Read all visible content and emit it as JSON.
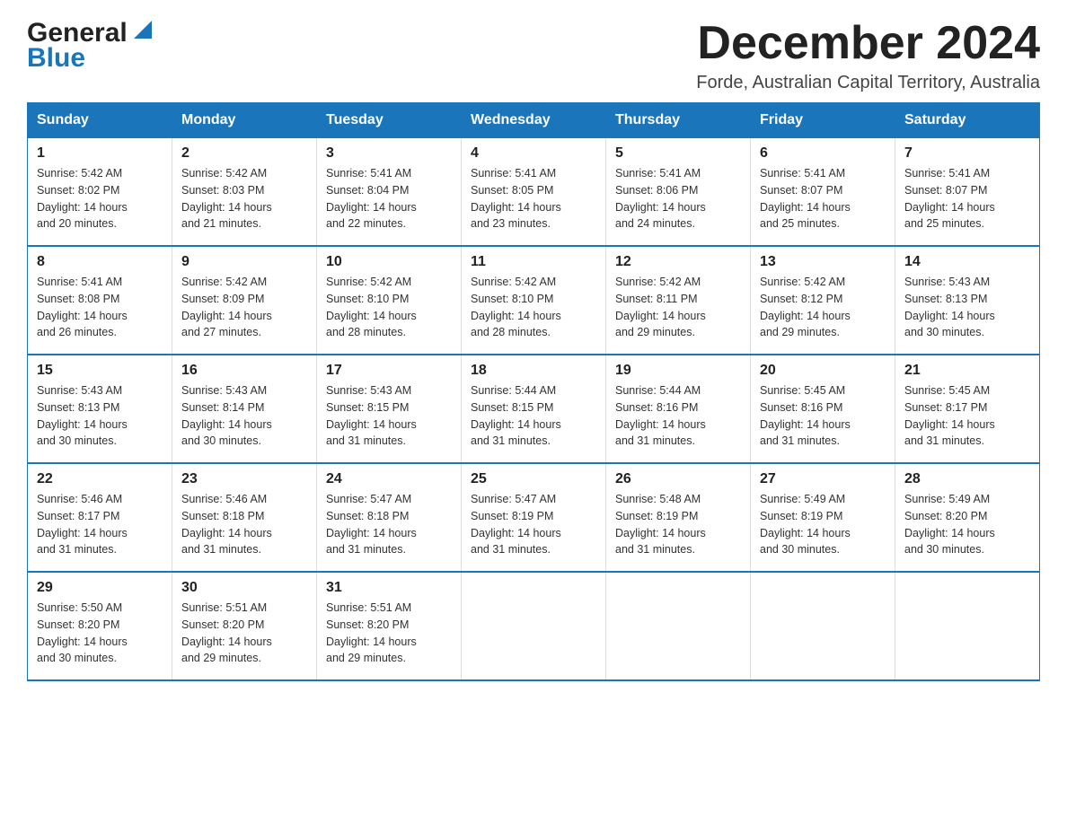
{
  "header": {
    "logo_general": "General",
    "logo_blue": "Blue",
    "month_title": "December 2024",
    "location": "Forde, Australian Capital Territory, Australia"
  },
  "days_of_week": [
    "Sunday",
    "Monday",
    "Tuesday",
    "Wednesday",
    "Thursday",
    "Friday",
    "Saturday"
  ],
  "weeks": [
    [
      {
        "day": "1",
        "sunrise": "5:42 AM",
        "sunset": "8:02 PM",
        "daylight": "14 hours and 20 minutes."
      },
      {
        "day": "2",
        "sunrise": "5:42 AM",
        "sunset": "8:03 PM",
        "daylight": "14 hours and 21 minutes."
      },
      {
        "day": "3",
        "sunrise": "5:41 AM",
        "sunset": "8:04 PM",
        "daylight": "14 hours and 22 minutes."
      },
      {
        "day": "4",
        "sunrise": "5:41 AM",
        "sunset": "8:05 PM",
        "daylight": "14 hours and 23 minutes."
      },
      {
        "day": "5",
        "sunrise": "5:41 AM",
        "sunset": "8:06 PM",
        "daylight": "14 hours and 24 minutes."
      },
      {
        "day": "6",
        "sunrise": "5:41 AM",
        "sunset": "8:07 PM",
        "daylight": "14 hours and 25 minutes."
      },
      {
        "day": "7",
        "sunrise": "5:41 AM",
        "sunset": "8:07 PM",
        "daylight": "14 hours and 25 minutes."
      }
    ],
    [
      {
        "day": "8",
        "sunrise": "5:41 AM",
        "sunset": "8:08 PM",
        "daylight": "14 hours and 26 minutes."
      },
      {
        "day": "9",
        "sunrise": "5:42 AM",
        "sunset": "8:09 PM",
        "daylight": "14 hours and 27 minutes."
      },
      {
        "day": "10",
        "sunrise": "5:42 AM",
        "sunset": "8:10 PM",
        "daylight": "14 hours and 28 minutes."
      },
      {
        "day": "11",
        "sunrise": "5:42 AM",
        "sunset": "8:10 PM",
        "daylight": "14 hours and 28 minutes."
      },
      {
        "day": "12",
        "sunrise": "5:42 AM",
        "sunset": "8:11 PM",
        "daylight": "14 hours and 29 minutes."
      },
      {
        "day": "13",
        "sunrise": "5:42 AM",
        "sunset": "8:12 PM",
        "daylight": "14 hours and 29 minutes."
      },
      {
        "day": "14",
        "sunrise": "5:43 AM",
        "sunset": "8:13 PM",
        "daylight": "14 hours and 30 minutes."
      }
    ],
    [
      {
        "day": "15",
        "sunrise": "5:43 AM",
        "sunset": "8:13 PM",
        "daylight": "14 hours and 30 minutes."
      },
      {
        "day": "16",
        "sunrise": "5:43 AM",
        "sunset": "8:14 PM",
        "daylight": "14 hours and 30 minutes."
      },
      {
        "day": "17",
        "sunrise": "5:43 AM",
        "sunset": "8:15 PM",
        "daylight": "14 hours and 31 minutes."
      },
      {
        "day": "18",
        "sunrise": "5:44 AM",
        "sunset": "8:15 PM",
        "daylight": "14 hours and 31 minutes."
      },
      {
        "day": "19",
        "sunrise": "5:44 AM",
        "sunset": "8:16 PM",
        "daylight": "14 hours and 31 minutes."
      },
      {
        "day": "20",
        "sunrise": "5:45 AM",
        "sunset": "8:16 PM",
        "daylight": "14 hours and 31 minutes."
      },
      {
        "day": "21",
        "sunrise": "5:45 AM",
        "sunset": "8:17 PM",
        "daylight": "14 hours and 31 minutes."
      }
    ],
    [
      {
        "day": "22",
        "sunrise": "5:46 AM",
        "sunset": "8:17 PM",
        "daylight": "14 hours and 31 minutes."
      },
      {
        "day": "23",
        "sunrise": "5:46 AM",
        "sunset": "8:18 PM",
        "daylight": "14 hours and 31 minutes."
      },
      {
        "day": "24",
        "sunrise": "5:47 AM",
        "sunset": "8:18 PM",
        "daylight": "14 hours and 31 minutes."
      },
      {
        "day": "25",
        "sunrise": "5:47 AM",
        "sunset": "8:19 PM",
        "daylight": "14 hours and 31 minutes."
      },
      {
        "day": "26",
        "sunrise": "5:48 AM",
        "sunset": "8:19 PM",
        "daylight": "14 hours and 31 minutes."
      },
      {
        "day": "27",
        "sunrise": "5:49 AM",
        "sunset": "8:19 PM",
        "daylight": "14 hours and 30 minutes."
      },
      {
        "day": "28",
        "sunrise": "5:49 AM",
        "sunset": "8:20 PM",
        "daylight": "14 hours and 30 minutes."
      }
    ],
    [
      {
        "day": "29",
        "sunrise": "5:50 AM",
        "sunset": "8:20 PM",
        "daylight": "14 hours and 30 minutes."
      },
      {
        "day": "30",
        "sunrise": "5:51 AM",
        "sunset": "8:20 PM",
        "daylight": "14 hours and 29 minutes."
      },
      {
        "day": "31",
        "sunrise": "5:51 AM",
        "sunset": "8:20 PM",
        "daylight": "14 hours and 29 minutes."
      },
      null,
      null,
      null,
      null
    ]
  ],
  "labels": {
    "sunrise": "Sunrise:",
    "sunset": "Sunset:",
    "daylight": "Daylight:"
  }
}
